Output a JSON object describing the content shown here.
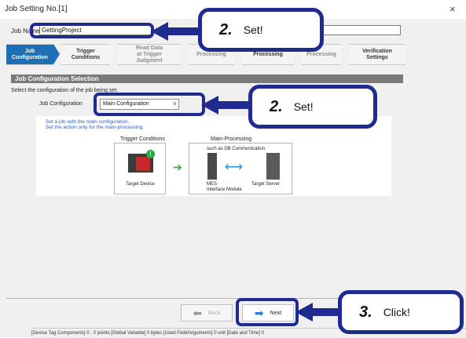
{
  "window": {
    "title": "Job Setting No.[1]",
    "close": "×"
  },
  "job_name": {
    "label": "Job Name",
    "value": "GettingProject"
  },
  "tabs": [
    {
      "label": "Job\nConfiguration",
      "active": true
    },
    {
      "label": "Trigger\nConditions"
    },
    {
      "label": "Read Data\nat Trigger\nJudgment"
    },
    {
      "label": "Processing"
    },
    {
      "label": "Processing"
    },
    {
      "label": "Processing"
    },
    {
      "label": "Verification\nSettings"
    }
  ],
  "section": {
    "header": "Job Configuration Selection",
    "prompt": "Select the configuration of the job being set.",
    "config_label": "Job Configuration",
    "config_value": "Main Configuration"
  },
  "description": {
    "line1": "Set a job with the main configuration.",
    "line2": "Set the action only for the main-processing."
  },
  "diagram": {
    "trigger_title": "Trigger Conditions",
    "target_device": "Target Device",
    "main_title": "Main-Processing",
    "db_comm": "such as DB Communication",
    "mes": "MES\nInterface Module",
    "server": "Target Server"
  },
  "buttons": {
    "back": "Back",
    "next": "Next"
  },
  "statusbar": "[Device Tag Components] 0 ,  0 points  [Global Variable]  0 bytes  [Used Field/Arguments]  0 unit  [Date and Time]  0",
  "callouts": [
    {
      "num": "2.",
      "text": "Set!"
    },
    {
      "num": "2.",
      "text": "Set!"
    },
    {
      "num": "3.",
      "text": "Click!"
    }
  ],
  "colors": {
    "accent": "#1e6fb5",
    "callout_border": "#1f2b8f",
    "green": "#2aa843"
  }
}
